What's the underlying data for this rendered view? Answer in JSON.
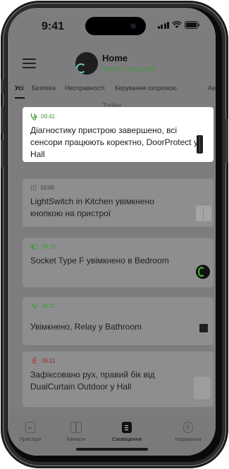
{
  "status_bar": {
    "time": "9:41"
  },
  "header": {
    "title": "Home",
    "status": "Знято з охорони"
  },
  "tabs": [
    {
      "label": "Усі"
    },
    {
      "label": "Безпека"
    },
    {
      "label": "Несправності"
    },
    {
      "label": "Керування охороною"
    },
    {
      "label": "Ав"
    }
  ],
  "section": {
    "label": "Today"
  },
  "notifications": [
    {
      "time": "09:41",
      "message": "Діагностику пристрою завершено, всі сенсори працюють коректно, DoorProtect у Hall",
      "icon": "stethoscope-icon",
      "accent": "#3f9a3a",
      "device": "doorprotect"
    },
    {
      "time": "10:00",
      "message": "LightSwitch in Kitchen увімкнено кнопкою на пристрої",
      "icon": "keypad-dots-icon",
      "accent": "#4a4a4a",
      "device": "lightswitch"
    },
    {
      "time": "09:15",
      "message": "Socket Type F увімкнено в Bedroom",
      "icon": "toggle-icon",
      "accent": "#3f9a3a",
      "device": "socket"
    },
    {
      "time": "06:11",
      "message": "Увімкнено, Relay у Bathroom",
      "icon": "pulse-icon",
      "accent": "#3f9a3a",
      "device": "relay"
    },
    {
      "time": "06:11",
      "message": "Зафіксовано рух, правий бік від DualCurtain Outdoor у Hall",
      "icon": "running-person-icon",
      "accent": "#a83a2a",
      "device": "dualcurtain"
    }
  ],
  "bottom_nav": [
    {
      "label": "Пристрої"
    },
    {
      "label": "Кімнати"
    },
    {
      "label": "Сповіщення"
    },
    {
      "label": "Керування"
    }
  ]
}
